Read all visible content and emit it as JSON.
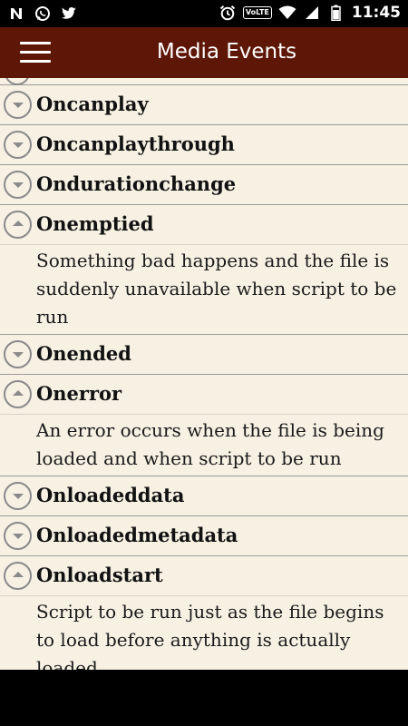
{
  "status_bar": {
    "left_icons": [
      "n-notification-icon",
      "whatsapp-icon",
      "twitter-icon"
    ],
    "right_icons": [
      "alarm-icon",
      "volte-icon",
      "wifi-icon",
      "signal-icon",
      "battery-icon"
    ],
    "volte_label": "VoLTE",
    "time": "11:45"
  },
  "toolbar": {
    "title": "Media Events",
    "background": "#5e1707"
  },
  "items": [
    {
      "title": "Oncanplay",
      "expanded": false,
      "description": ""
    },
    {
      "title": "Oncanplaythrough",
      "expanded": false,
      "description": ""
    },
    {
      "title": "Ondurationchange",
      "expanded": false,
      "description": ""
    },
    {
      "title": "Onemptied",
      "expanded": true,
      "description": "Something bad happens and the file is suddenly unavailable when script to be run"
    },
    {
      "title": "Onended",
      "expanded": false,
      "description": ""
    },
    {
      "title": "Onerror",
      "expanded": true,
      "description": "An error occurs when the file is being loaded and when script to be run"
    },
    {
      "title": "Onloadeddata",
      "expanded": false,
      "description": ""
    },
    {
      "title": "Onloadedmetadata",
      "expanded": false,
      "description": ""
    },
    {
      "title": "Onloadstart",
      "expanded": true,
      "description": "Script to be run just as the file begins to load before anything is actually loaded"
    }
  ]
}
